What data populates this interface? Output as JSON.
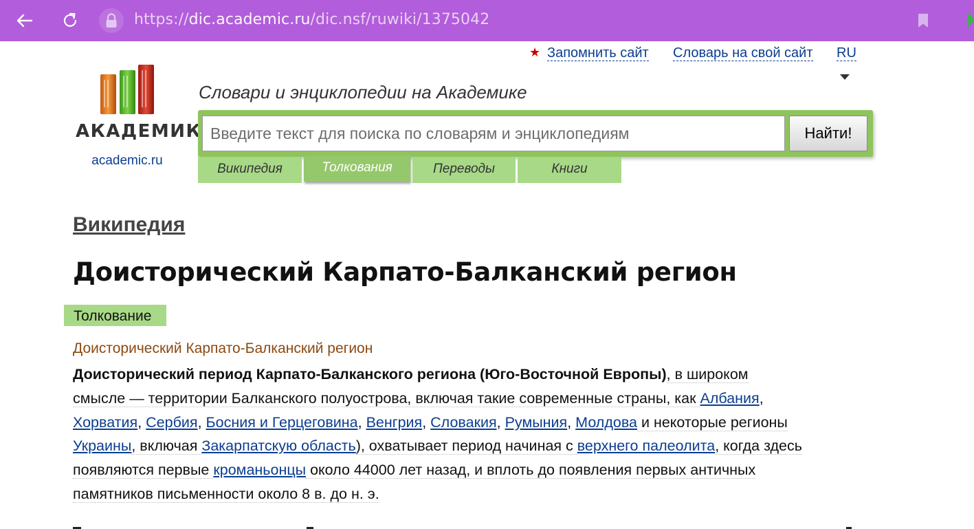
{
  "browser": {
    "url_scheme": "https://",
    "url_host": "dic.academic.ru",
    "url_path": "/dic.nsf/ruwiki/1375042",
    "theme_color": "#b25ddb"
  },
  "top_links": {
    "remember": "Запомнить сайт",
    "dictionary_for_site": "Словарь на свой сайт",
    "language": "RU"
  },
  "logo": {
    "word": "АКАДЕМИК",
    "domain": "academic.ru"
  },
  "tagline": "Словари и энциклопедии на Академике",
  "search": {
    "placeholder": "Введите текст для поиска по словарям и энциклопедиям",
    "button": "Найти!"
  },
  "tabs": [
    {
      "label": "Википедия",
      "active": false
    },
    {
      "label": "Толкования",
      "active": true
    },
    {
      "label": "Переводы",
      "active": false
    },
    {
      "label": "Книги",
      "active": false
    }
  ],
  "content": {
    "section": "Википедия",
    "title": "Доисторический Карпато-Балканский регион",
    "badge": "Толкование",
    "term": "Доисторический Карпато-Балканский регион",
    "bold_lead": "Доисторический период Карпато-Балканского региона (Юго-Восточной Европы)",
    "t1": ", в широком",
    "t2": "смысле — территории Балканского полуострова, включая такие современные страны, как ",
    "link_albania": "Албания",
    "comma": ",",
    "link_croatia": "Хорватия",
    "link_serbia": "Сербия",
    "link_bosnia": "Босния и Герцеговина",
    "link_hungary": "Венгрия",
    "link_slovakia": "Словакия",
    "link_romania": "Румыния",
    "link_moldova": "Молдова",
    "t3": " и некоторые регионы",
    "link_ukraine": "Украины",
    "t4": ", включая ",
    "link_zakarpattia": "Закарпатскую область",
    "t5": "), охватывает период начиная с ",
    "link_upper_paleolithic": "верхнего палеолита",
    "t6": ", когда здесь",
    "t7": "появляются первые ",
    "link_cromagnon": "кроманьонцы",
    "t8": " около 44000 лет назад, и вплоть до появления первых античных",
    "t9": "памятников письменности около 8 в. до н. э."
  },
  "colors": {
    "accent_green": "#a8d987",
    "link_blue": "#0b3d91",
    "term_brown": "#8a4a12"
  }
}
